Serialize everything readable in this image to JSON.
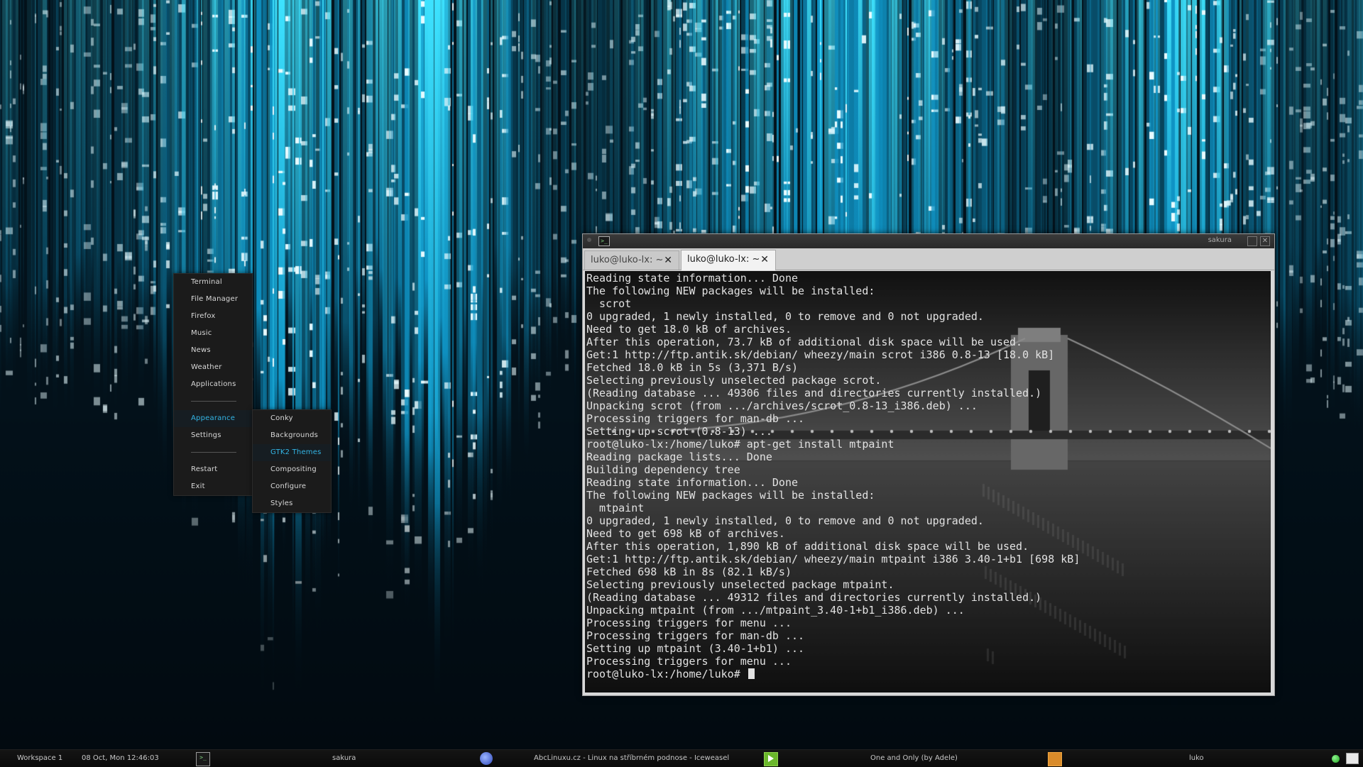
{
  "wallpaper": {
    "colors": {
      "bright": "#3ee3ff",
      "mid": "#0f93c4",
      "dark": "#041722"
    }
  },
  "menu": {
    "items": [
      {
        "label": "Terminal"
      },
      {
        "label": "File Manager"
      },
      {
        "label": "Firefox"
      },
      {
        "label": "Music"
      },
      {
        "label": "News"
      },
      {
        "label": "Weather"
      },
      {
        "label": "Applications"
      },
      {
        "label": "Appearance",
        "active": true
      },
      {
        "label": "Settings"
      },
      {
        "label": "Restart"
      },
      {
        "label": "Exit"
      }
    ],
    "submenu": [
      {
        "label": "Conky"
      },
      {
        "label": "Backgrounds"
      },
      {
        "label": "GTK2 Themes",
        "active": true
      },
      {
        "label": "Compositing"
      },
      {
        "label": "Configure"
      },
      {
        "label": "Styles"
      }
    ],
    "accent_color": "#33b5e5"
  },
  "terminal": {
    "title": "sakura",
    "tabs": [
      {
        "label": "luko@luko-lx: ~"
      },
      {
        "label": "luko@luko-lx: ~",
        "active": true
      }
    ],
    "lines": [
      "Reading state information... Done",
      "The following NEW packages will be installed:",
      "  scrot",
      "0 upgraded, 1 newly installed, 0 to remove and 0 not upgraded.",
      "Need to get 18.0 kB of archives.",
      "After this operation, 73.7 kB of additional disk space will be used.",
      "Get:1 http://ftp.antik.sk/debian/ wheezy/main scrot i386 0.8-13 [18.0 kB]",
      "Fetched 18.0 kB in 5s (3,371 B/s)",
      "Selecting previously unselected package scrot.",
      "(Reading database ... 49306 files and directories currently installed.)",
      "Unpacking scrot (from .../archives/scrot_0.8-13_i386.deb) ...",
      "Processing triggers for man-db ...",
      "Setting up scrot (0.8-13) ...",
      "root@luko-lx:/home/luko# apt-get install mtpaint",
      "Reading package lists... Done",
      "Building dependency tree",
      "Reading state information... Done",
      "The following NEW packages will be installed:",
      "  mtpaint",
      "0 upgraded, 1 newly installed, 0 to remove and 0 not upgraded.",
      "Need to get 698 kB of archives.",
      "After this operation, 1,890 kB of additional disk space will be used.",
      "Get:1 http://ftp.antik.sk/debian/ wheezy/main mtpaint i386 3.40-1+b1 [698 kB]",
      "Fetched 698 kB in 8s (82.1 kB/s)",
      "Selecting previously unselected package mtpaint.",
      "(Reading database ... 49312 files and directories currently installed.)",
      "Unpacking mtpaint (from .../mtpaint_3.40-1+b1_i386.deb) ...",
      "Processing triggers for menu ...",
      "Processing triggers for man-db ...",
      "Setting up mtpaint (3.40-1+b1) ...",
      "Processing triggers for menu ..."
    ],
    "prompt": "root@luko-lx:/home/luko# "
  },
  "taskbar": {
    "workspace": "Workspace 1",
    "clock": "08 Oct, Mon 12:46:03",
    "tasks": [
      {
        "label": "sakura",
        "icon": "terminal-icon"
      },
      {
        "label": "AbcLinuxu.cz - Linux na stříbrném podnose - Iceweasel",
        "icon": "browser-icon"
      },
      {
        "label": "One and Only (by Adele)",
        "icon": "media-player-icon"
      },
      {
        "label": "luko",
        "icon": "file-manager-icon"
      }
    ],
    "tray": [
      {
        "icon": "network-status-icon"
      },
      {
        "icon": "window-list-icon"
      }
    ]
  }
}
